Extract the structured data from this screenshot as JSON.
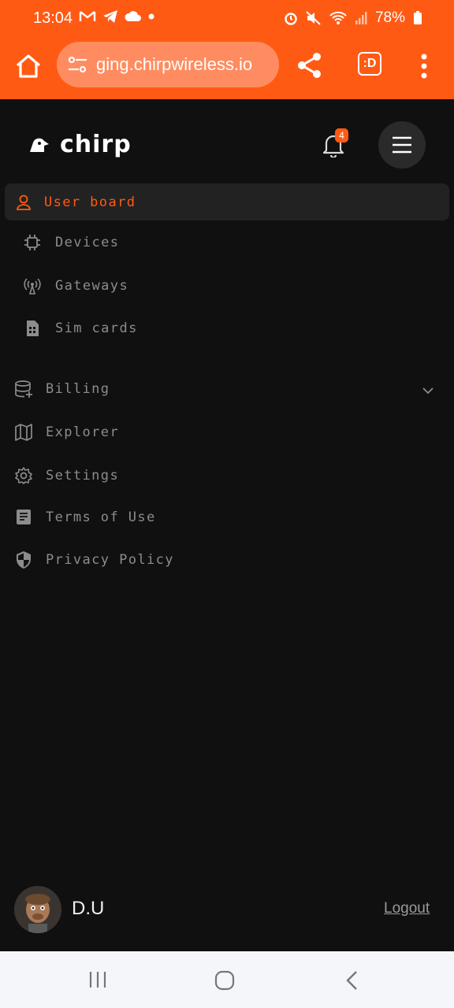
{
  "status_bar": {
    "time": "13:04",
    "battery": "78%"
  },
  "browser": {
    "url": "ging.chirpwireless.io",
    "tabs_label": ":D"
  },
  "app": {
    "brand": "chirp",
    "notification_count": "4"
  },
  "nav": {
    "items": [
      {
        "label": "User board",
        "icon": "user-icon",
        "active": true
      },
      {
        "label": "Devices",
        "icon": "chip-icon"
      },
      {
        "label": "Gateways",
        "icon": "antenna-icon"
      },
      {
        "label": "Sim cards",
        "icon": "sim-card-icon"
      },
      {
        "label": "Billing",
        "icon": "database-plus-icon"
      },
      {
        "label": "Explorer",
        "icon": "map-icon"
      },
      {
        "label": "Settings",
        "icon": "gear-icon"
      },
      {
        "label": "Terms of Use",
        "icon": "document-icon"
      },
      {
        "label": "Privacy Policy",
        "icon": "shield-icon"
      }
    ]
  },
  "user": {
    "name": "D.U",
    "logout_label": "Logout"
  },
  "colors": {
    "accent": "#ff5a14",
    "background": "#101010"
  }
}
